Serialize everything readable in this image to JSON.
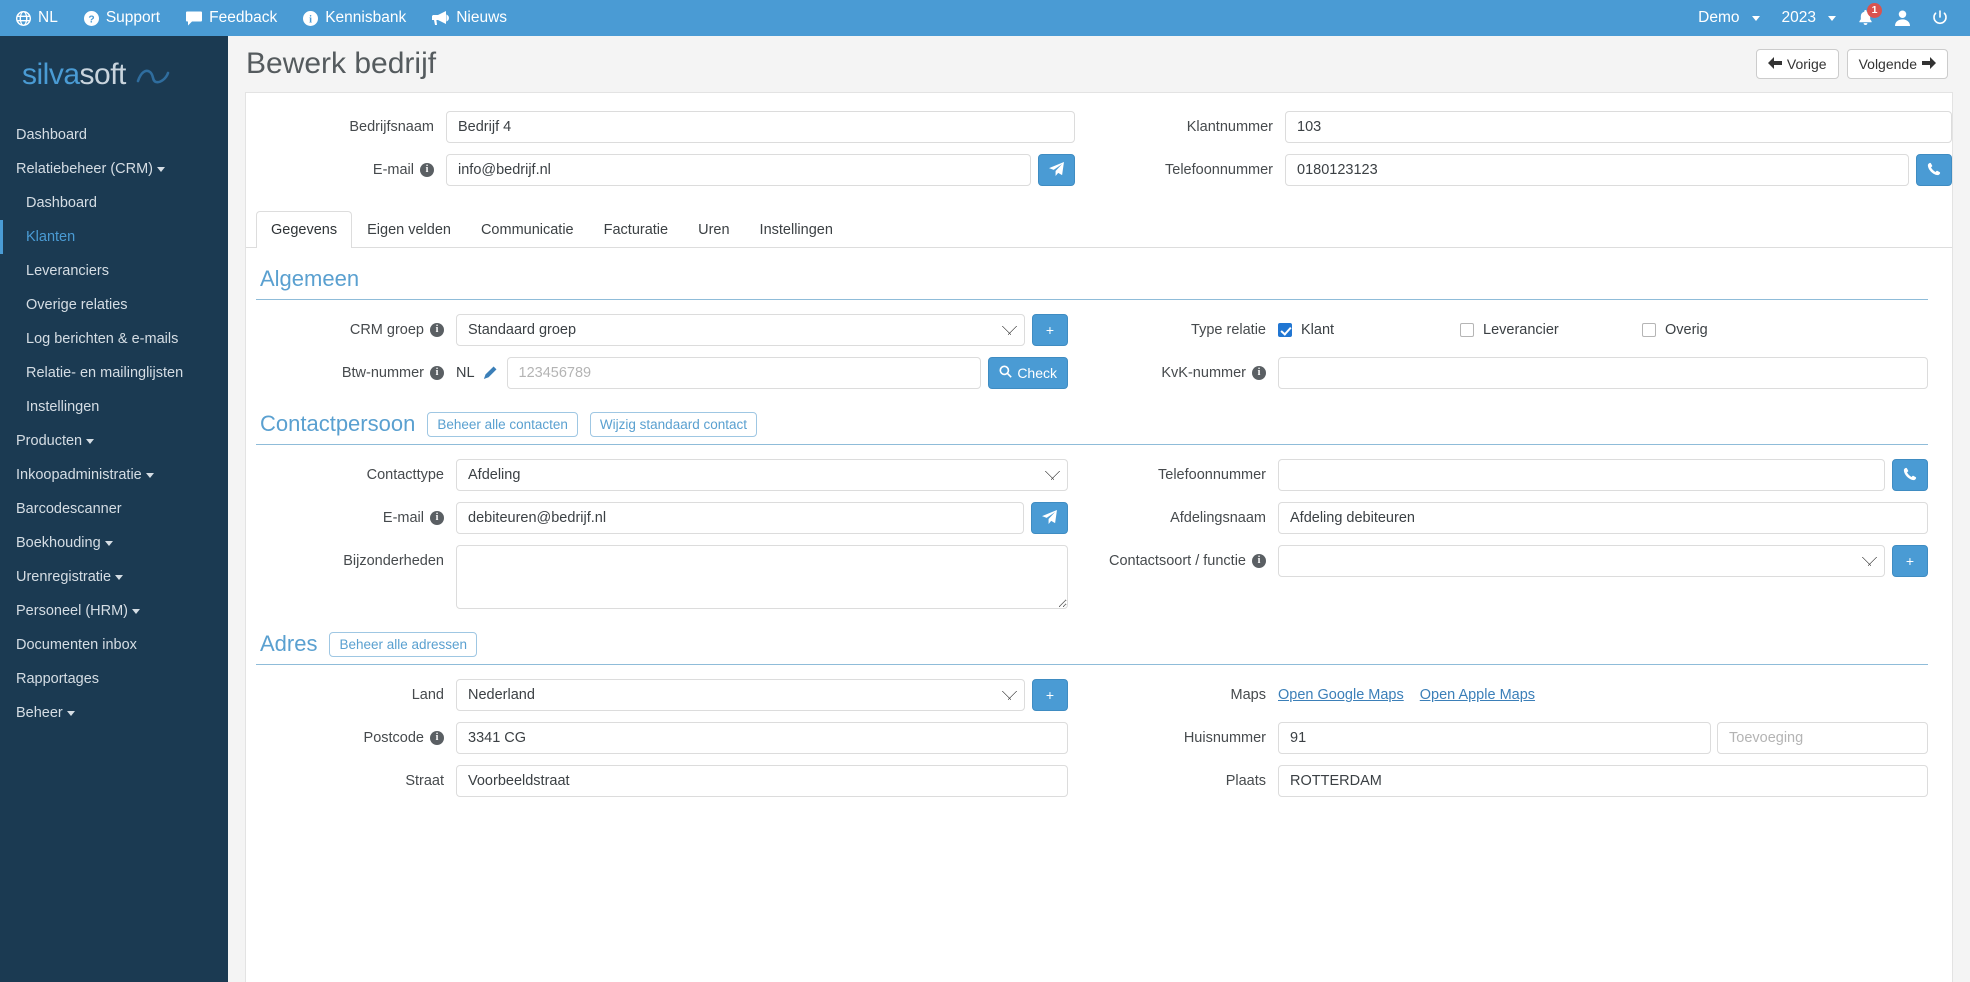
{
  "topbar": {
    "left_items": [
      {
        "label": "NL",
        "icon": "globe-icon"
      },
      {
        "label": "Support",
        "icon": "question-circle-icon"
      },
      {
        "label": "Feedback",
        "icon": "comment-icon"
      },
      {
        "label": "Kennisbank",
        "icon": "info-circle-icon"
      },
      {
        "label": "Nieuws",
        "icon": "megaphone-icon"
      }
    ],
    "account_label": "Demo",
    "year_label": "2023",
    "notification_count": "1",
    "user_icon": "user-icon",
    "logout_icon": "power-icon",
    "bell_icon": "bell-icon",
    "background": "#4a9bd4"
  },
  "sidebar": {
    "logo_part1": "silva",
    "logo_part2": "soft",
    "items": [
      {
        "label": "Dashboard",
        "level": "top",
        "caret": false,
        "active": false
      },
      {
        "label": "Relatiebeheer (CRM)",
        "level": "top",
        "caret": true,
        "active": false
      },
      {
        "label": "Dashboard",
        "level": "sub",
        "caret": false,
        "active": false
      },
      {
        "label": "Klanten",
        "level": "sub",
        "caret": false,
        "active": true
      },
      {
        "label": "Leveranciers",
        "level": "sub",
        "caret": false,
        "active": false
      },
      {
        "label": "Overige relaties",
        "level": "sub",
        "caret": false,
        "active": false
      },
      {
        "label": "Log berichten & e-mails",
        "level": "sub",
        "caret": false,
        "active": false
      },
      {
        "label": "Relatie- en mailinglijsten",
        "level": "sub",
        "caret": false,
        "active": false
      },
      {
        "label": "Instellingen",
        "level": "sub",
        "caret": false,
        "active": false
      },
      {
        "label": "Producten",
        "level": "top",
        "caret": true,
        "active": false
      },
      {
        "label": "Inkoopadministratie",
        "level": "top",
        "caret": true,
        "active": false
      },
      {
        "label": "Barcodescanner",
        "level": "top",
        "caret": false,
        "active": false
      },
      {
        "label": "Boekhouding",
        "level": "top",
        "caret": true,
        "active": false
      },
      {
        "label": "Urenregistratie",
        "level": "top",
        "caret": true,
        "active": false
      },
      {
        "label": "Personeel (HRM)",
        "level": "top",
        "caret": true,
        "active": false
      },
      {
        "label": "Documenten inbox",
        "level": "top",
        "caret": false,
        "active": false
      },
      {
        "label": "Rapportages",
        "level": "top",
        "caret": false,
        "active": false
      },
      {
        "label": "Beheer",
        "level": "top",
        "caret": true,
        "active": false
      }
    ],
    "background": "#1b3a52",
    "accent": "#4a9bd4"
  },
  "header": {
    "title": "Bewerk bedrijf",
    "prev_label": "Vorige",
    "next_label": "Volgende"
  },
  "top_form": {
    "bedrijfsnaam_label": "Bedrijfsnaam",
    "bedrijfsnaam_value": "Bedrijf 4",
    "klantnummer_label": "Klantnummer",
    "klantnummer_value": "103",
    "email_label": "E-mail",
    "email_value": "info@bedrijf.nl",
    "telefoonnummer_label": "Telefoonnummer",
    "telefoonnummer_value": "0180123123"
  },
  "tabs": [
    {
      "label": "Gegevens",
      "active": true
    },
    {
      "label": "Eigen velden",
      "active": false
    },
    {
      "label": "Communicatie",
      "active": false
    },
    {
      "label": "Facturatie",
      "active": false
    },
    {
      "label": "Uren",
      "active": false
    },
    {
      "label": "Instellingen",
      "active": false
    }
  ],
  "algemeen": {
    "title": "Algemeen",
    "crm_groep_label": "CRM groep",
    "crm_groep_value": "Standaard groep",
    "btw_label": "Btw-nummer",
    "btw_prefix": "NL",
    "btw_placeholder": "123456789",
    "btw_value": "",
    "check_label": "Check",
    "type_relatie_label": "Type relatie",
    "type_relatie_options": [
      {
        "label": "Klant",
        "checked": true
      },
      {
        "label": "Leverancier",
        "checked": false
      },
      {
        "label": "Overig",
        "checked": false
      }
    ],
    "kvk_label": "KvK-nummer",
    "kvk_value": ""
  },
  "contactpersoon": {
    "title": "Contactpersoon",
    "manage_contacts_label": "Beheer alle contacten",
    "change_default_label": "Wijzig standaard contact",
    "contacttype_label": "Contacttype",
    "contacttype_value": "Afdeling",
    "email_label": "E-mail",
    "email_value": "debiteuren@bedrijf.nl",
    "bijzonderheden_label": "Bijzonderheden",
    "bijzonderheden_value": "",
    "telefoonnummer_label": "Telefoonnummer",
    "telefoonnummer_value": "",
    "afdelingsnaam_label": "Afdelingsnaam",
    "afdelingsnaam_value": "Afdeling debiteuren",
    "contactsoort_label": "Contactsoort / functie",
    "contactsoort_value": ""
  },
  "adres": {
    "title": "Adres",
    "manage_addresses_label": "Beheer alle adressen",
    "land_label": "Land",
    "land_value": "Nederland",
    "postcode_label": "Postcode",
    "postcode_value": "3341 CG",
    "straat_label": "Straat",
    "straat_value": "Voorbeeldstraat",
    "maps_label": "Maps",
    "google_maps_label": "Open Google Maps",
    "apple_maps_label": "Open Apple Maps",
    "huisnummer_label": "Huisnummer",
    "huisnummer_value": "91",
    "toevoeging_placeholder": "Toevoeging",
    "toevoeging_value": "",
    "plaats_label": "Plaats",
    "plaats_value": "ROTTERDAM"
  }
}
